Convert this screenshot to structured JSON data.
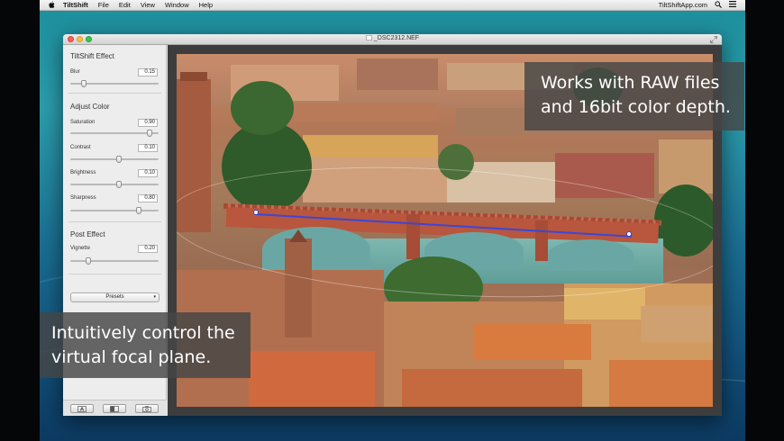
{
  "menubar": {
    "app_name": "TiltShift",
    "items": [
      "File",
      "Edit",
      "View",
      "Window",
      "Help"
    ],
    "right_text": "TiltShiftApp.com"
  },
  "window": {
    "title": "_DSC2312.NEF"
  },
  "sidebar": {
    "tiltshift_effect": {
      "title": "TiltShift Effect",
      "blur": {
        "label": "Blur",
        "value": "0.15",
        "level": 0.15
      }
    },
    "adjust_color": {
      "title": "Adjust Color",
      "saturation": {
        "label": "Saturation",
        "value": "0.90",
        "level": 0.9
      },
      "contrast": {
        "label": "Contrast",
        "value": "0.10",
        "level": 0.55
      },
      "brightness": {
        "label": "Brightness",
        "value": "0.10",
        "level": 0.55
      },
      "sharpness": {
        "label": "Sharpness",
        "value": "0.80",
        "level": 0.78
      }
    },
    "post_effect": {
      "title": "Post Effect",
      "vignette": {
        "label": "Vignette",
        "value": "0.20",
        "level": 0.2
      }
    },
    "presets_label": "Presets"
  },
  "captions": {
    "top_right": [
      "Works with RAW files",
      "and 16bit color depth."
    ],
    "bottom_left": [
      "Intuitively control the",
      "virtual focal plane."
    ]
  },
  "icons": {
    "apple": "apple-logo-icon",
    "search": "search-icon",
    "list": "list-icon",
    "fullscreen": "fullscreen-icon"
  },
  "colors": {
    "focus_line": "#3c46d8",
    "caption_bg": "#464646"
  }
}
